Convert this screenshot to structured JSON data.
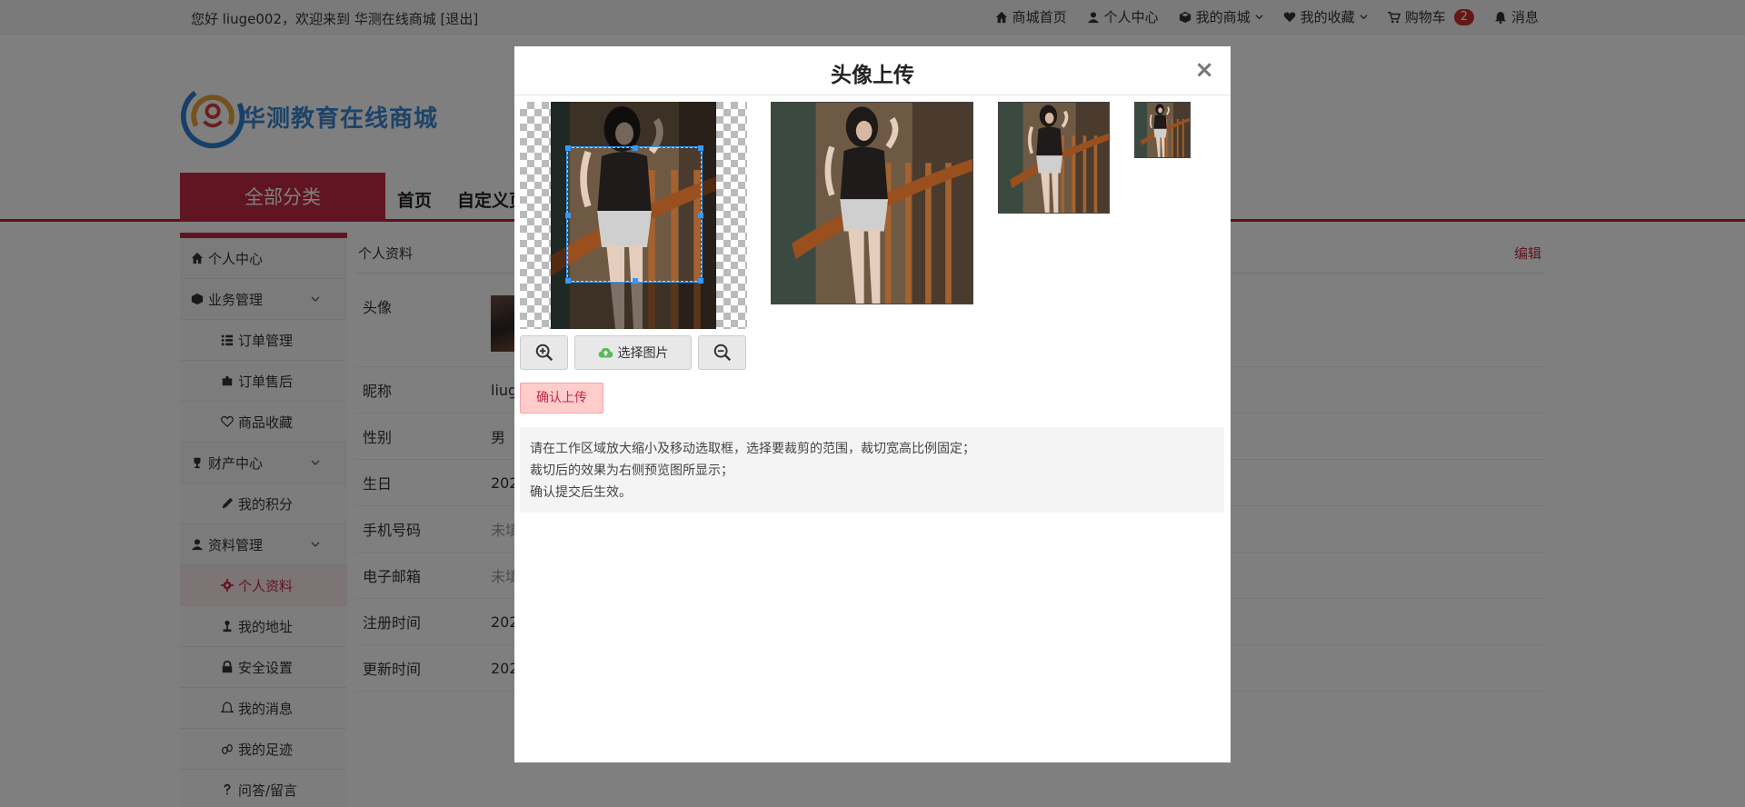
{
  "topbar": {
    "greeting": "您好 liuge002，欢迎来到 华测在线商城",
    "logout": "[退出]",
    "nav": [
      {
        "label": "商城首页",
        "icon": "home-icon"
      },
      {
        "label": "个人中心",
        "icon": "user-icon"
      },
      {
        "label": "我的商城",
        "icon": "cube-icon"
      },
      {
        "label": "我的收藏",
        "icon": "heart-icon"
      },
      {
        "label": "购物车",
        "icon": "cart-icon"
      },
      {
        "label": "消息",
        "icon": "bell-icon"
      }
    ],
    "cart_count": "2"
  },
  "header": {
    "brand": "华测教育在线商城"
  },
  "mainnav": {
    "all_categories": "全部分类",
    "links": [
      "首页",
      "自定义页"
    ]
  },
  "sidebar": {
    "items": [
      {
        "label": "个人中心"
      },
      {
        "label": "业务管理"
      },
      {
        "label": "订单管理"
      },
      {
        "label": "订单售后"
      },
      {
        "label": "商品收藏"
      },
      {
        "label": "财产中心"
      },
      {
        "label": "我的积分"
      },
      {
        "label": "资料管理"
      },
      {
        "label": "个人资料"
      },
      {
        "label": "我的地址"
      },
      {
        "label": "安全设置"
      },
      {
        "label": "我的消息"
      },
      {
        "label": "我的足迹"
      },
      {
        "label": "问答/留言"
      }
    ]
  },
  "content": {
    "title": "个人资料",
    "edit": "编辑",
    "rows": [
      {
        "label": "头像",
        "value": ""
      },
      {
        "label": "昵称",
        "value": "liug"
      },
      {
        "label": "性别",
        "value": "男"
      },
      {
        "label": "生日",
        "value": "202"
      },
      {
        "label": "手机号码",
        "value": "未填"
      },
      {
        "label": "电子邮箱",
        "value": "未填"
      },
      {
        "label": "注册时间",
        "value": "202"
      },
      {
        "label": "更新时间",
        "value": "202"
      }
    ]
  },
  "modal": {
    "title": "头像上传",
    "close": "×",
    "select_image": "选择图片",
    "confirm": "确认上传",
    "hint_lines": [
      "请在工作区域放大缩小及移动选取框，选择要裁剪的范围，裁切宽高比例固定；",
      "裁切后的效果为右侧预览图所显示；",
      "确认提交后生效。"
    ]
  }
}
